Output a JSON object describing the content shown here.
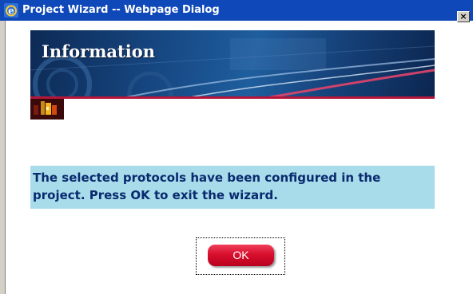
{
  "window": {
    "title": "Project Wizard -- Webpage Dialog",
    "close_glyph": "×",
    "title_icon": "ie-icon",
    "title_bar_color": "#0f48b8"
  },
  "banner": {
    "title": "Information",
    "accent_line_color": "#b3163a"
  },
  "wizard_icon": "wizard-icon",
  "message": {
    "text": "The selected protocols have been configured in the project. Press OK to exit the wizard.",
    "background_color": "#a8dcea",
    "text_color": "#0a2a6e"
  },
  "ok_button": {
    "label": "OK",
    "color": "#d8102e"
  }
}
